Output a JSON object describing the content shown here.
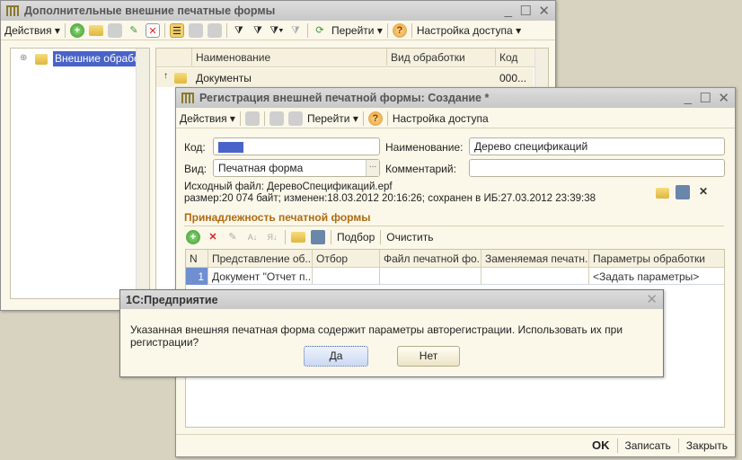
{
  "main_window": {
    "title": "Дополнительные внешние печатные формы",
    "toolbar": {
      "actions": "Действия ▾",
      "goto": "Перейти ▾",
      "help": "?",
      "access": "Настройка доступа ▾"
    },
    "tree": {
      "root": "Внешние обработк"
    },
    "table": {
      "columns": [
        "Наименование",
        "Вид обработки",
        "Код"
      ],
      "rows": [
        {
          "name": "Документы",
          "type": "",
          "code": "000..."
        }
      ]
    }
  },
  "form_window": {
    "title": "Регистрация внешней печатной формы: Создание *",
    "toolbar": {
      "actions": "Действия ▾",
      "goto": "Перейти ▾",
      "help": "?",
      "access": "Настройка доступа"
    },
    "fields": {
      "code_label": "Код:",
      "code_value": "",
      "name_label": "Наименование:",
      "name_value": "Дерево спецификаций",
      "kind_label": "Вид:",
      "kind_value": "Печатная форма",
      "kind_button": "...",
      "comment_label": "Комментарий:",
      "comment_value": ""
    },
    "file_info": {
      "line1": "Исходный файл: ДеревоСпецификаций.epf",
      "line2": "размер:20 074 байт; изменен:18.03.2012 20:16:26; сохранен в ИБ:27.03.2012 23:39:38"
    },
    "section_title": "Принадлежность печатной формы",
    "section_toolbar": {
      "select": "Подбор",
      "clear": "Очистить"
    },
    "table": {
      "columns": [
        "N",
        "Представление об...",
        "Отбор",
        "Файл печатной фо...",
        "Заменяемая печатн...",
        "Параметры обработки"
      ],
      "rows": [
        {
          "n": "1",
          "repr": "Документ \"Отчет п...",
          "filter": "",
          "file": "",
          "replace": "",
          "params": "<Задать параметры>"
        }
      ]
    },
    "footer": {
      "ok": "OK",
      "save": "Записать",
      "close": "Закрыть"
    }
  },
  "dialog": {
    "title": "1С:Предприятие",
    "message": "Указанная внешняя печатная форма содержит параметры авторегистрации. Использовать их при регистрации?",
    "yes": "Да",
    "no": "Нет"
  },
  "accent": "#4a63c8"
}
